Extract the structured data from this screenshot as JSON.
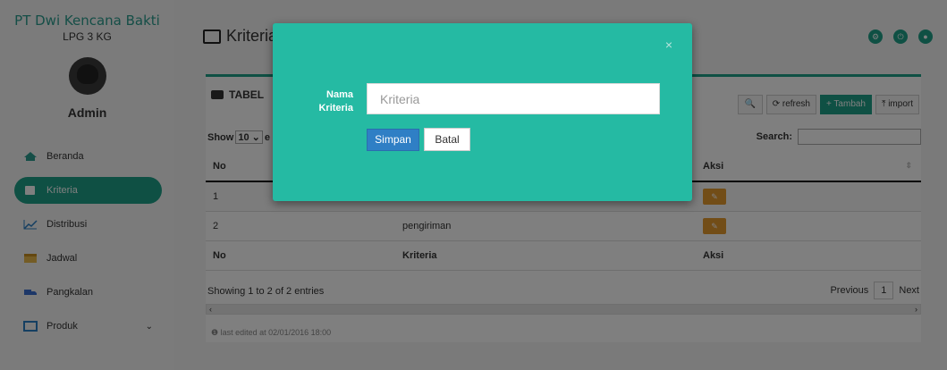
{
  "sidebar": {
    "brand_line1": "PT Dwi Kencana Bakti",
    "brand_line2": "LPG 3 KG",
    "user_name": "Admin",
    "items": [
      {
        "label": "Beranda",
        "icon": "home-icon",
        "active": false
      },
      {
        "label": "Kriteria",
        "icon": "tag-icon",
        "active": true
      },
      {
        "label": "Distribusi",
        "icon": "line-chart-icon",
        "active": false
      },
      {
        "label": "Jadwal",
        "icon": "calendar-icon",
        "active": false
      },
      {
        "label": "Pangkalan",
        "icon": "truck-icon",
        "active": false
      },
      {
        "label": "Produk",
        "icon": "window-icon",
        "active": false
      }
    ],
    "produk_chevron": "⌄"
  },
  "header": {
    "title": "Kriteria",
    "icons": [
      "settings-icon",
      "power-icon",
      "user-icon"
    ]
  },
  "panel": {
    "title": "TABEL",
    "tools": {
      "search_icon": "🔍",
      "refresh_label": "refresh",
      "tambah_label": "Tambah",
      "import_label": "import"
    },
    "length_prefix": "Show",
    "length_value": "10 ⌄",
    "length_suffix": "e",
    "search_label": "Search:",
    "columns": [
      "No",
      "",
      "Aksi"
    ],
    "rows": [
      {
        "no": "1",
        "kriteria": ""
      },
      {
        "no": "2",
        "kriteria": "pengiriman"
      }
    ],
    "footer_columns": [
      "No",
      "Kriteria",
      "Aksi"
    ],
    "info": "Showing 1 to 2 of 2 entries",
    "pager": {
      "previous": "Previous",
      "page": "1",
      "next": "Next"
    },
    "scroll_left": "‹",
    "scroll_right": "›",
    "last_edited": "❶ last edited at 02/01/2016 18:00"
  },
  "modal": {
    "close": "×",
    "field_label": "Nama Kriteria",
    "field_placeholder": "Kriteria",
    "field_value": "",
    "save_label": "Simpan",
    "cancel_label": "Batal"
  },
  "colors": {
    "accent": "#1fa188",
    "modal_bg": "#25baa3",
    "save_btn": "#2f7fc5",
    "edit_btn": "#e59a2f"
  }
}
